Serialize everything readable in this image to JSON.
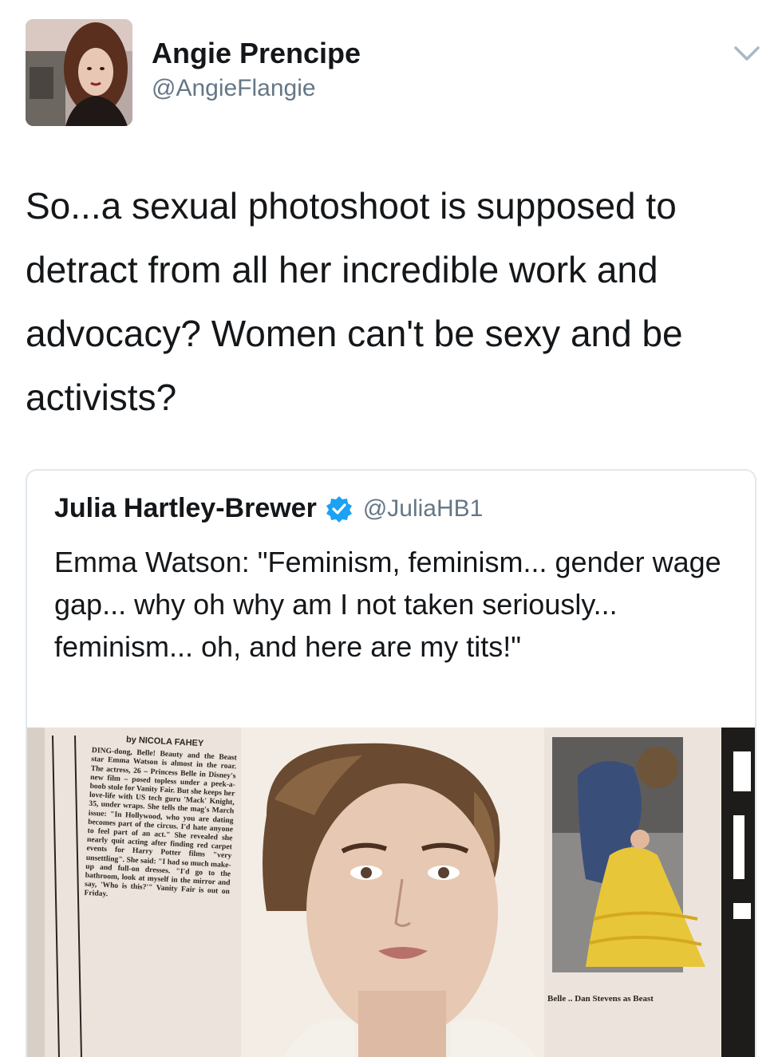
{
  "author": {
    "name": "Angie Prencipe",
    "handle": "@AngieFlangie",
    "avatar_icon": "profile-photo"
  },
  "tweet": {
    "text": "So...a sexual photoshoot is supposed to detract from all her incredible work and advocacy? Women can't be sexy and be activists?"
  },
  "menu_icon": "chevron-down-icon",
  "quoted": {
    "name": "Julia Hartley-Brewer",
    "verified_icon": "verified-badge-icon",
    "handle": "@JuliaHB1",
    "text": "Emma Watson: \"Feminism, feminism... gender wage gap... why oh why am I not taken seriously... feminism... oh, and here are my tits!\"",
    "media": {
      "byline": "by NICOLA FAHEY",
      "article": "DING-dong, Belle! Beauty and the Beast star Emma Watson is almost in the roar. The actress, 26 – Princess Belle in Disney's new film – posed topless under a peek-a-boob stole for Vanity Fair. But she keeps her love-life with US tech guru 'Mack' Knight, 35, under wraps. She tells the mag's March issue: \"In Hollywood, who you are dating becomes part of the circus. I'd hate anyone to feel part of an act.\" She revealed she nearly quit acting after finding red carpet events for Harry Potter films \"very unsettling\". She said: \"I had so much make-up and full-on dresses. \"I'd go to the bathroom, look at myself in the mirror and say, 'Who is this?'\" Vanity Fair is out on Friday.",
      "caption": "Belle .. Dan Stevens as Beast"
    }
  },
  "colors": {
    "text": "#14171a",
    "secondary": "#657786",
    "border": "#e1e8ed",
    "verified": "#1da1f2"
  }
}
